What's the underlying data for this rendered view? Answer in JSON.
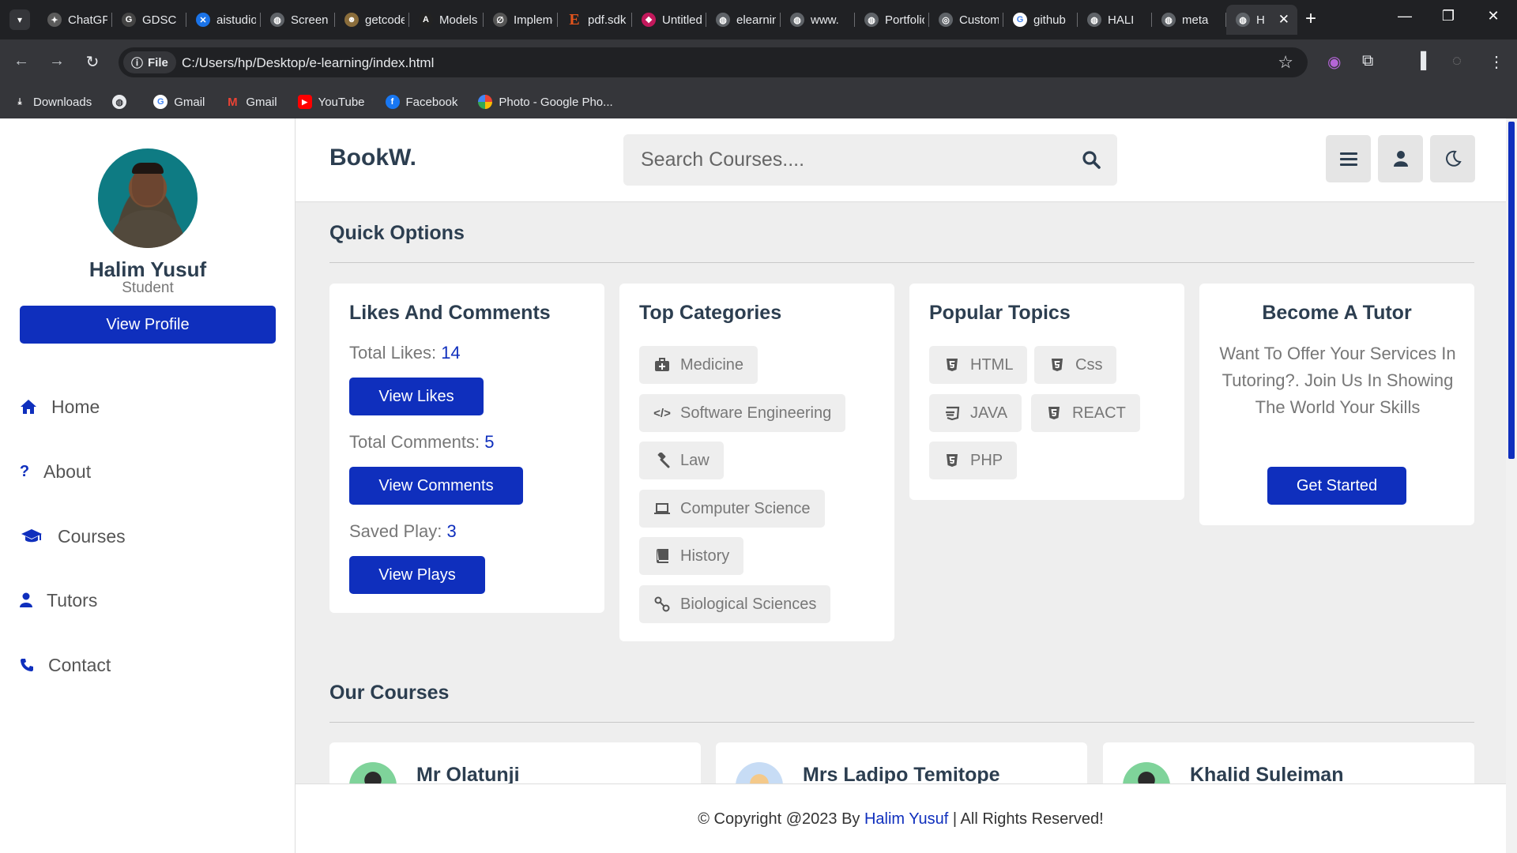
{
  "browser": {
    "tabs": [
      {
        "title": "ChatGPT",
        "icon": "chatgpt-icon",
        "color": "#5b5b5b"
      },
      {
        "title": "GDSC",
        "icon": "gdsc-icon",
        "color": "#444"
      },
      {
        "title": "aistudio",
        "icon": "aistudio-icon",
        "color": "#1a73e8"
      },
      {
        "title": "Screen",
        "icon": "globe-icon",
        "color": "#5f6368"
      },
      {
        "title": "getcode",
        "icon": "getcode-icon",
        "color": "#8a6d3b"
      },
      {
        "title": "Models",
        "icon": "models-icon",
        "color": "#222"
      },
      {
        "title": "Implement",
        "icon": "implement-icon",
        "color": "#555"
      },
      {
        "title": "pdf.sdk",
        "icon": "pdf-icon",
        "color": "#e2541c"
      },
      {
        "title": "Untitled",
        "icon": "untitled-icon",
        "color": "#c2185b"
      },
      {
        "title": "elearning",
        "icon": "globe-icon",
        "color": "#5f6368"
      },
      {
        "title": "www.",
        "icon": "globe-icon",
        "color": "#5f6368"
      },
      {
        "title": "Portfolio",
        "icon": "globe-icon",
        "color": "#5f6368"
      },
      {
        "title": "Custom",
        "icon": "custom-icon",
        "color": "#5f6368"
      },
      {
        "title": "github",
        "icon": "google-icon",
        "color": "#4285f4"
      },
      {
        "title": "HALI",
        "icon": "globe-icon",
        "color": "#5f6368"
      },
      {
        "title": "meta",
        "icon": "globe-icon",
        "color": "#5f6368"
      }
    ],
    "active_tab_title": "H",
    "file_chip": "File",
    "url": "C:/Users/hp/Desktop/e-learning/index.html",
    "bookmarks": [
      {
        "label": "Downloads",
        "icon": "download-icon",
        "color": "#35363a"
      },
      {
        "label": "",
        "icon": "globe-icon",
        "color": "#35363a"
      },
      {
        "label": "Gmail",
        "icon": "google-icon",
        "color": "#4285f4"
      },
      {
        "label": "Gmail",
        "icon": "gmail-icon",
        "color": "#ea4335"
      },
      {
        "label": "YouTube",
        "icon": "youtube-icon",
        "color": "#ff0000"
      },
      {
        "label": "Facebook",
        "icon": "facebook-icon",
        "color": "#1877f2"
      },
      {
        "label": "Photo - Google Pho...",
        "icon": "google-photos-icon",
        "color": "#fbbc04"
      }
    ]
  },
  "sidebar": {
    "name": "Halim Yusuf",
    "role": "Student",
    "profile_button": "View Profile",
    "nav": [
      {
        "label": "Home",
        "icon": "home-icon"
      },
      {
        "label": "About",
        "icon": "question-icon"
      },
      {
        "label": "Courses",
        "icon": "graduation-cap-icon"
      },
      {
        "label": "Tutors",
        "icon": "user-icon"
      },
      {
        "label": "Contact",
        "icon": "phone-icon"
      }
    ]
  },
  "header": {
    "logo": "BookW.",
    "search_placeholder": "Search Courses....",
    "accent": "#0f2fbd"
  },
  "quick_options": {
    "title": "Quick Options",
    "likes_card": {
      "title": "Likes And Comments",
      "likes_label": "Total Likes:",
      "likes_value": "14",
      "likes_button": "View Likes",
      "comments_label": "Total Comments:",
      "comments_value": "5",
      "comments_button": "View Comments",
      "plays_label": "Saved Play:",
      "plays_value": "3",
      "plays_button": "View Plays"
    },
    "categories_card": {
      "title": "Top Categories",
      "items": [
        {
          "label": "Medicine",
          "icon": "medkit-icon"
        },
        {
          "label": "Software Engineering",
          "icon": "code-icon"
        },
        {
          "label": "Law",
          "icon": "gavel-icon"
        },
        {
          "label": "Computer Science",
          "icon": "laptop-icon"
        },
        {
          "label": "History",
          "icon": "book-icon"
        },
        {
          "label": "Biological Sciences",
          "icon": "dna-icon"
        }
      ]
    },
    "topics_card": {
      "title": "Popular Topics",
      "items": [
        {
          "label": "HTML",
          "icon": "html5-icon"
        },
        {
          "label": "Css",
          "icon": "css3-icon"
        },
        {
          "label": "JAVA",
          "icon": "js-icon"
        },
        {
          "label": "REACT",
          "icon": "react-icon"
        },
        {
          "label": "PHP",
          "icon": "php-icon"
        }
      ]
    },
    "tutor_card": {
      "title": "Become A Tutor",
      "text": "Want To Offer Your Services In Tutoring?. Join Us In Showing The World Your Skills",
      "button": "Get Started"
    }
  },
  "courses": {
    "title": "Our Courses",
    "items": [
      {
        "tutor": "Mr Olatunji"
      },
      {
        "tutor": "Mrs Ladipo Temitope"
      },
      {
        "tutor": "Khalid Suleiman"
      }
    ]
  },
  "footer": {
    "prefix": "© Copyright @2023 By",
    "author": "Halim Yusuf",
    "suffix": "| All Rights Reserved!"
  }
}
